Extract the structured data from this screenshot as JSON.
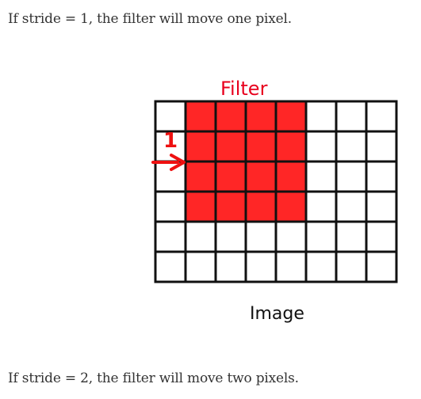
{
  "text": {
    "intro": "If stride = 1, the filter will move one pixel.",
    "outro": "If stride = 2, the filter will move two pixels."
  },
  "figure": {
    "filter_label": "Filter",
    "image_label": "Image",
    "stride_marker": "1",
    "grid_columns": 8,
    "grid_rows": 6,
    "filter_size": 4,
    "filter_start_column": 1,
    "filter_start_row": 0,
    "colors": {
      "filter_fill": "#ff2626",
      "filter_line": "#d0121c",
      "label_red": "#e8001d",
      "arrow": "#ee1111",
      "grid_line": "#111111"
    }
  }
}
